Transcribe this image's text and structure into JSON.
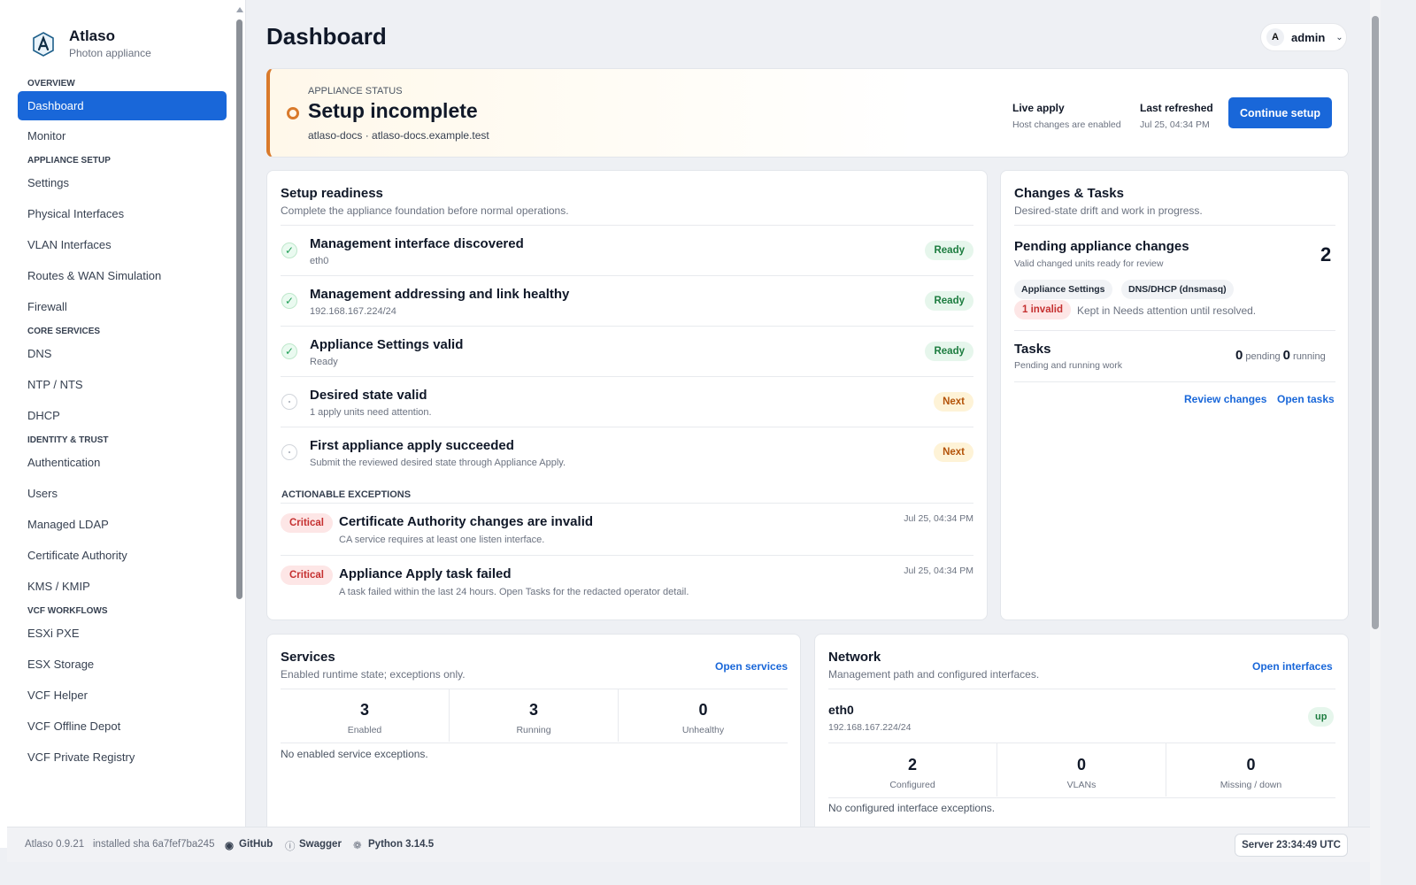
{
  "sidebar": {
    "brand_name": "Atlaso",
    "brand_sub": "Photon appliance",
    "sections": [
      {
        "label": "Overview",
        "items": [
          "Dashboard",
          "Monitor"
        ]
      },
      {
        "label": "Appliance setup",
        "items": [
          "Settings",
          "Physical Interfaces",
          "VLAN Interfaces",
          "Routes & WAN Simulation",
          "Firewall"
        ]
      },
      {
        "label": "Core services",
        "items": [
          "DNS",
          "NTP / NTS",
          "DHCP"
        ]
      },
      {
        "label": "Identity & trust",
        "items": [
          "Authentication",
          "Users",
          "Managed LDAP",
          "Certificate Authority",
          "KMS / KMIP"
        ]
      },
      {
        "label": "VCF workflows",
        "items": [
          "ESXi PXE",
          "ESX Storage",
          "VCF Helper",
          "VCF Offline Depot",
          "VCF Private Registry"
        ]
      }
    ],
    "active_item": "Dashboard"
  },
  "header": {
    "title": "Dashboard",
    "user_initial": "A",
    "user_name": "admin"
  },
  "status": {
    "label": "Appliance status",
    "title": "Setup incomplete",
    "host": "atlaso-docs · atlaso-docs.example.test",
    "live_apply_label": "Live apply",
    "live_apply_value": "Host changes are enabled",
    "refreshed_label": "Last refreshed",
    "refreshed_value": "Jul 25, 04:34 PM",
    "button": "Continue setup",
    "accent_color": "#d97a2b"
  },
  "readiness": {
    "title": "Setup readiness",
    "subtitle": "Complete the appliance foundation before normal operations.",
    "items": [
      {
        "title": "Management interface discovered",
        "detail": "eth0",
        "badge": "Ready",
        "state": "done"
      },
      {
        "title": "Management addressing and link healthy",
        "detail": "192.168.167.224/24",
        "badge": "Ready",
        "state": "done"
      },
      {
        "title": "Appliance Settings valid",
        "detail": "Ready",
        "badge": "Ready",
        "state": "done"
      },
      {
        "title": "Desired state valid",
        "detail": "1 apply units need attention.",
        "badge": "Next",
        "state": "pending"
      },
      {
        "title": "First appliance apply succeeded",
        "detail": "Submit the reviewed desired state through Appliance Apply.",
        "badge": "Next",
        "state": "pending"
      }
    ],
    "exceptions_label": "Actionable exceptions",
    "exceptions": [
      {
        "severity": "Critical",
        "title": "Certificate Authority changes are invalid",
        "detail": "CA service requires at least one listen interface.",
        "time": "Jul 25, 04:34 PM"
      },
      {
        "severity": "Critical",
        "title": "Appliance Apply task failed",
        "detail": "A task failed within the last 24 hours. Open Tasks for the redacted operator detail.",
        "time": "Jul 25, 04:34 PM"
      }
    ]
  },
  "changes": {
    "title": "Changes & Tasks",
    "subtitle": "Desired-state drift and work in progress.",
    "pending_title": "Pending appliance changes",
    "pending_sub": "Valid changed units ready for review",
    "pending_count": "2",
    "chips": [
      "Appliance Settings",
      "DNS/DHCP (dnsmasq)"
    ],
    "invalid_badge": "1 invalid",
    "invalid_note": "Kept in Needs attention until resolved.",
    "tasks_title": "Tasks",
    "tasks_sub": "Pending and running work",
    "pending_tasks": "0",
    "pending_word": "pending",
    "running_tasks": "0",
    "running_word": "running",
    "review_link": "Review changes",
    "tasks_link": "Open tasks"
  },
  "services": {
    "title": "Services",
    "subtitle": "Enabled runtime state; exceptions only.",
    "link": "Open services",
    "stats": [
      {
        "value": "3",
        "label": "Enabled"
      },
      {
        "value": "3",
        "label": "Running"
      },
      {
        "value": "0",
        "label": "Unhealthy"
      }
    ],
    "note": "No enabled service exceptions."
  },
  "network": {
    "title": "Network",
    "subtitle": "Management path and configured interfaces.",
    "link": "Open interfaces",
    "iface": "eth0",
    "iface_addr": "192.168.167.224/24",
    "iface_state": "up",
    "stats": [
      {
        "value": "2",
        "label": "Configured"
      },
      {
        "value": "0",
        "label": "VLANs"
      },
      {
        "value": "0",
        "label": "Missing / down"
      }
    ],
    "note": "No configured interface exceptions."
  },
  "footer": {
    "version": "Atlaso 0.9.21",
    "sha": "installed sha 6a7fef7ba245",
    "github": "GitHub",
    "swagger": "Swagger",
    "python": "Python 3.14.5",
    "server": "Server 23:34:49 UTC"
  }
}
